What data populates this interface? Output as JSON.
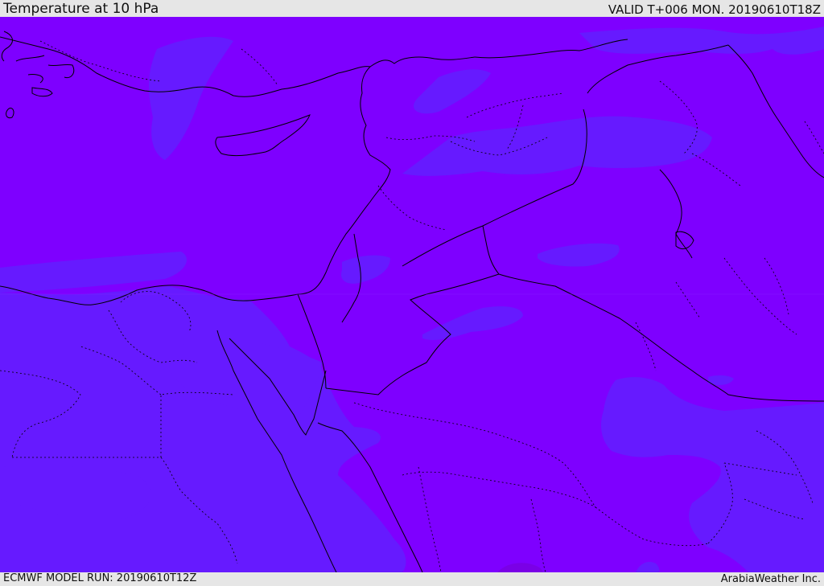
{
  "header": {
    "title": "Temperature at 10 hPa",
    "valid_time": "VALID T+006 MON. 20190610T18Z"
  },
  "footer": {
    "model_run": "ECMWF MODEL RUN: 20190610T12Z",
    "credit": "ArabiaWeather Inc."
  },
  "colors": {
    "field_warm": "#7e00ff",
    "field_cool": "#661aff",
    "field_hot_spot": "#7a00e6",
    "coastline": "#000000",
    "frame_background": "#e6e6e6"
  }
}
